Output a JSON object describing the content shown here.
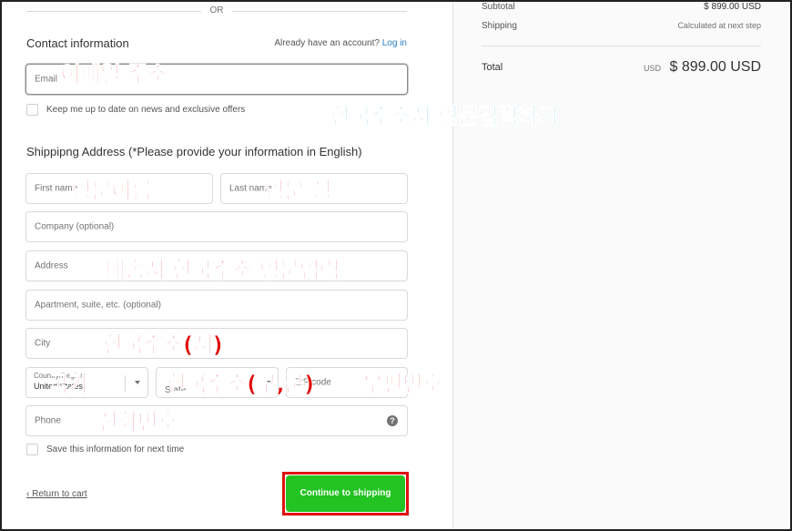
{
  "divider": {
    "or": "OR"
  },
  "contact": {
    "title": "Contact information",
    "login_prompt": "Already have an account?",
    "login_link": "Log in",
    "email_placeholder": "Email",
    "newsletter_label": "Keep me up to date on news and exclusive offers"
  },
  "shipping": {
    "title": "Shippipng Address (*Please provide your information in English)",
    "first_name_placeholder": "First name",
    "last_name_placeholder": "Last name",
    "company_placeholder": "Company (optional)",
    "address_placeholder": "Address",
    "apartment_placeholder": "Apartment, suite, etc. (optional)",
    "city_placeholder": "City",
    "country_label": "Country/Region",
    "country_value": "United States",
    "state_placeholder": "State",
    "zip_placeholder": "ZIP code",
    "phone_placeholder": "Phone",
    "save_info_label": "Save this information for next time"
  },
  "footer": {
    "return_link": "‹  Return to cart",
    "continue_button": "Continue to shipping"
  },
  "summary": {
    "subtotal_label": "Subtotal",
    "subtotal_value": "$ 899.00 USD",
    "shipping_label": "Shipping",
    "shipping_value": "Calculated at next step",
    "total_label": "Total",
    "total_currency": "USD",
    "total_value": "$ 899.00 USD"
  },
  "annotations": {
    "email": "이메일 주소",
    "english_address": "한국주소지 영문입력하기",
    "first_name": "영문이름",
    "last_name": "영문 성",
    "address": "배송지 한국주소 영문입력",
    "city": "한국주소(시)",
    "country": "국가",
    "state": "한국주소(구,군)",
    "zip": "우편번호",
    "phone": "전화번호"
  },
  "colors": {
    "cta_green": "#22c322",
    "cta_outline_red": "#e01010",
    "annotation_red": "#e00000",
    "annotation_blue": "#1a9bd7",
    "link_blue": "#2a7fc1"
  }
}
